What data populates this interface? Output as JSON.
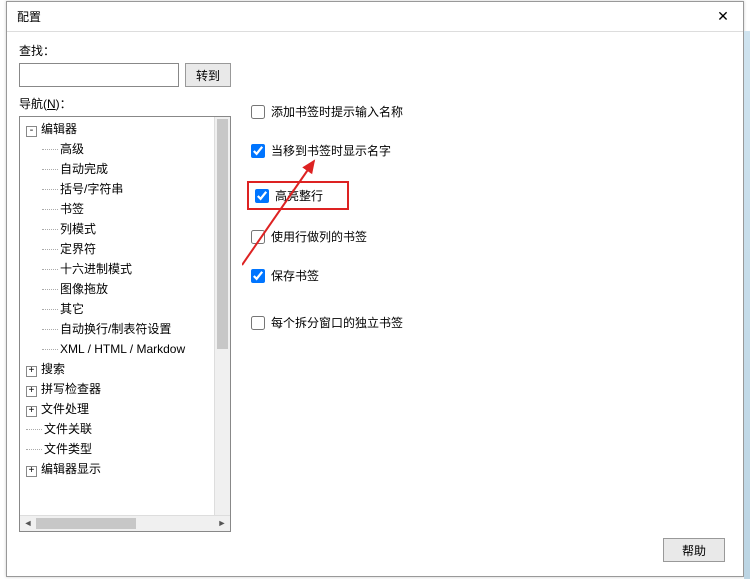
{
  "title": "配置",
  "search": {
    "label": "查找：",
    "value": "",
    "goto_label": "转到"
  },
  "nav": {
    "label_prefix": "导航(",
    "label_key": "N",
    "label_suffix": ")："
  },
  "tree": [
    {
      "level": 0,
      "expander": "-",
      "label": "编辑器"
    },
    {
      "level": 1,
      "expander": "",
      "label": "高级"
    },
    {
      "level": 1,
      "expander": "",
      "label": "自动完成"
    },
    {
      "level": 1,
      "expander": "",
      "label": "括号/字符串"
    },
    {
      "level": 1,
      "expander": "",
      "label": "书签"
    },
    {
      "level": 1,
      "expander": "",
      "label": "列模式"
    },
    {
      "level": 1,
      "expander": "",
      "label": "定界符"
    },
    {
      "level": 1,
      "expander": "",
      "label": "十六进制模式"
    },
    {
      "level": 1,
      "expander": "",
      "label": "图像拖放"
    },
    {
      "level": 1,
      "expander": "",
      "label": "其它"
    },
    {
      "level": 1,
      "expander": "",
      "label": "自动换行/制表符设置"
    },
    {
      "level": 1,
      "expander": "",
      "label": "XML / HTML / Markdow"
    },
    {
      "level": 0,
      "expander": "+",
      "label": "搜索"
    },
    {
      "level": 0,
      "expander": "+",
      "label": "拼写检查器"
    },
    {
      "level": 0,
      "expander": "+",
      "label": "文件处理"
    },
    {
      "level": 0,
      "expander": "",
      "label": "文件关联"
    },
    {
      "level": 0,
      "expander": "",
      "label": "文件类型"
    },
    {
      "level": 0,
      "expander": "+",
      "label": "编辑器显示"
    }
  ],
  "options": {
    "add_bookmark_prompt": {
      "label": "添加书签时提示输入名称",
      "checked": false
    },
    "show_name_on_move": {
      "label": "当移到书签时显示名字",
      "checked": true
    },
    "highlight_row": {
      "label": "高亮整行",
      "checked": true
    },
    "row_as_col_bm": {
      "label": "使用行做列的书签",
      "checked": false
    },
    "save_bookmarks": {
      "label": "保存书签",
      "checked": true
    },
    "per_split_bm": {
      "label": "每个拆分窗口的独立书签",
      "checked": false
    }
  },
  "footer": {
    "help_label": "帮助"
  }
}
